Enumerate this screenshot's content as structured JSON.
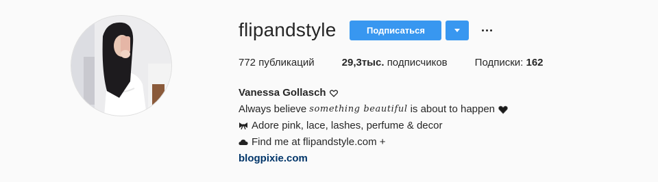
{
  "profile": {
    "username": "flipandstyle",
    "follow_label": "Подписаться",
    "avatar_alt": "profile-photo"
  },
  "stats": {
    "posts_value": "772",
    "posts_label": "публикаций",
    "followers_value": "29,3тыс.",
    "followers_label": "подписчиков",
    "following_label": "Подписки:",
    "following_value": "162"
  },
  "bio": {
    "full_name": "Vanessa Gollasch",
    "line1_before": "Always believe",
    "line1_script": "something beautiful",
    "line1_after": "is about to happen",
    "line2": "Adore pink, lace, lashes, perfume & decor",
    "line3": "Find me at flipandstyle.com +",
    "link": "blogpixie.com"
  },
  "icons": {
    "name_heart": "heart-outline-icon",
    "line1_heart": "black-heart-icon",
    "line2_bow": "ribbon-icon",
    "line3_cloud": "cloud-icon"
  },
  "colors": {
    "accent": "#3897f0",
    "link": "#003569",
    "text": "#262626",
    "background": "#fafafa"
  }
}
